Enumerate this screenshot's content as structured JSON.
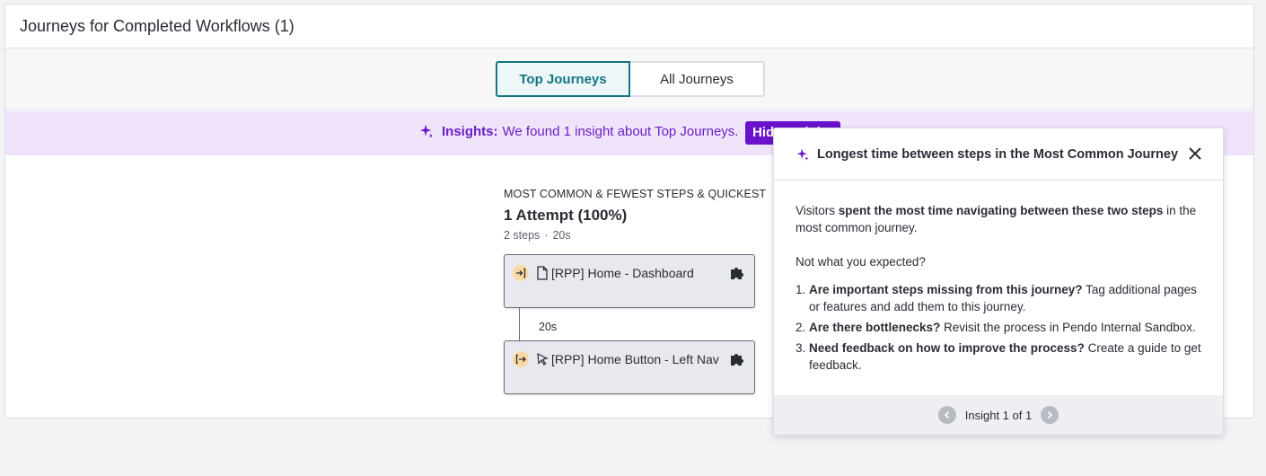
{
  "card": {
    "title": "Journeys for Completed Workflows (1)"
  },
  "tabs": {
    "top": "Top Journeys",
    "all": "All Journeys"
  },
  "banner": {
    "label": "Insights:",
    "text": "We found 1 insight about Top Journeys.",
    "button": "Hide Insights"
  },
  "journey": {
    "kicker": "MOST COMMON & FEWEST STEPS & QUICKEST",
    "title": "1 Attempt (100%)",
    "steps_count": "2 steps",
    "duration": "20s",
    "steps": [
      {
        "label": "[RPP] Home - Dashboard",
        "icon": "enter-icon",
        "type": "page-icon"
      },
      {
        "label": "[RPP] Home Button - Left Nav",
        "icon": "exit-icon",
        "type": "cursor-icon"
      }
    ],
    "gap_label": "20s"
  },
  "insight": {
    "title": "Longest time between steps in the Most Common Journey",
    "intro_pre": "Visitors ",
    "intro_bold": "spent the most time navigating between these two steps",
    "intro_post": " in the most common journey.",
    "question": "Not what you expected?",
    "items": [
      {
        "bold": "Are important steps missing from this journey?",
        "text": " Tag additional pages or features and add them to this journey."
      },
      {
        "bold": "Are there bottlenecks?",
        "text": " Revisit the process in Pendo Internal Sandbox."
      },
      {
        "bold": "Need feedback on how to improve the process?",
        "text": " Create a guide to get feedback."
      }
    ],
    "pager": "Insight 1 of 1"
  },
  "colors": {
    "accent": "#137584",
    "insight": "#6a12cc",
    "banner_bg": "#f0e4fb"
  }
}
